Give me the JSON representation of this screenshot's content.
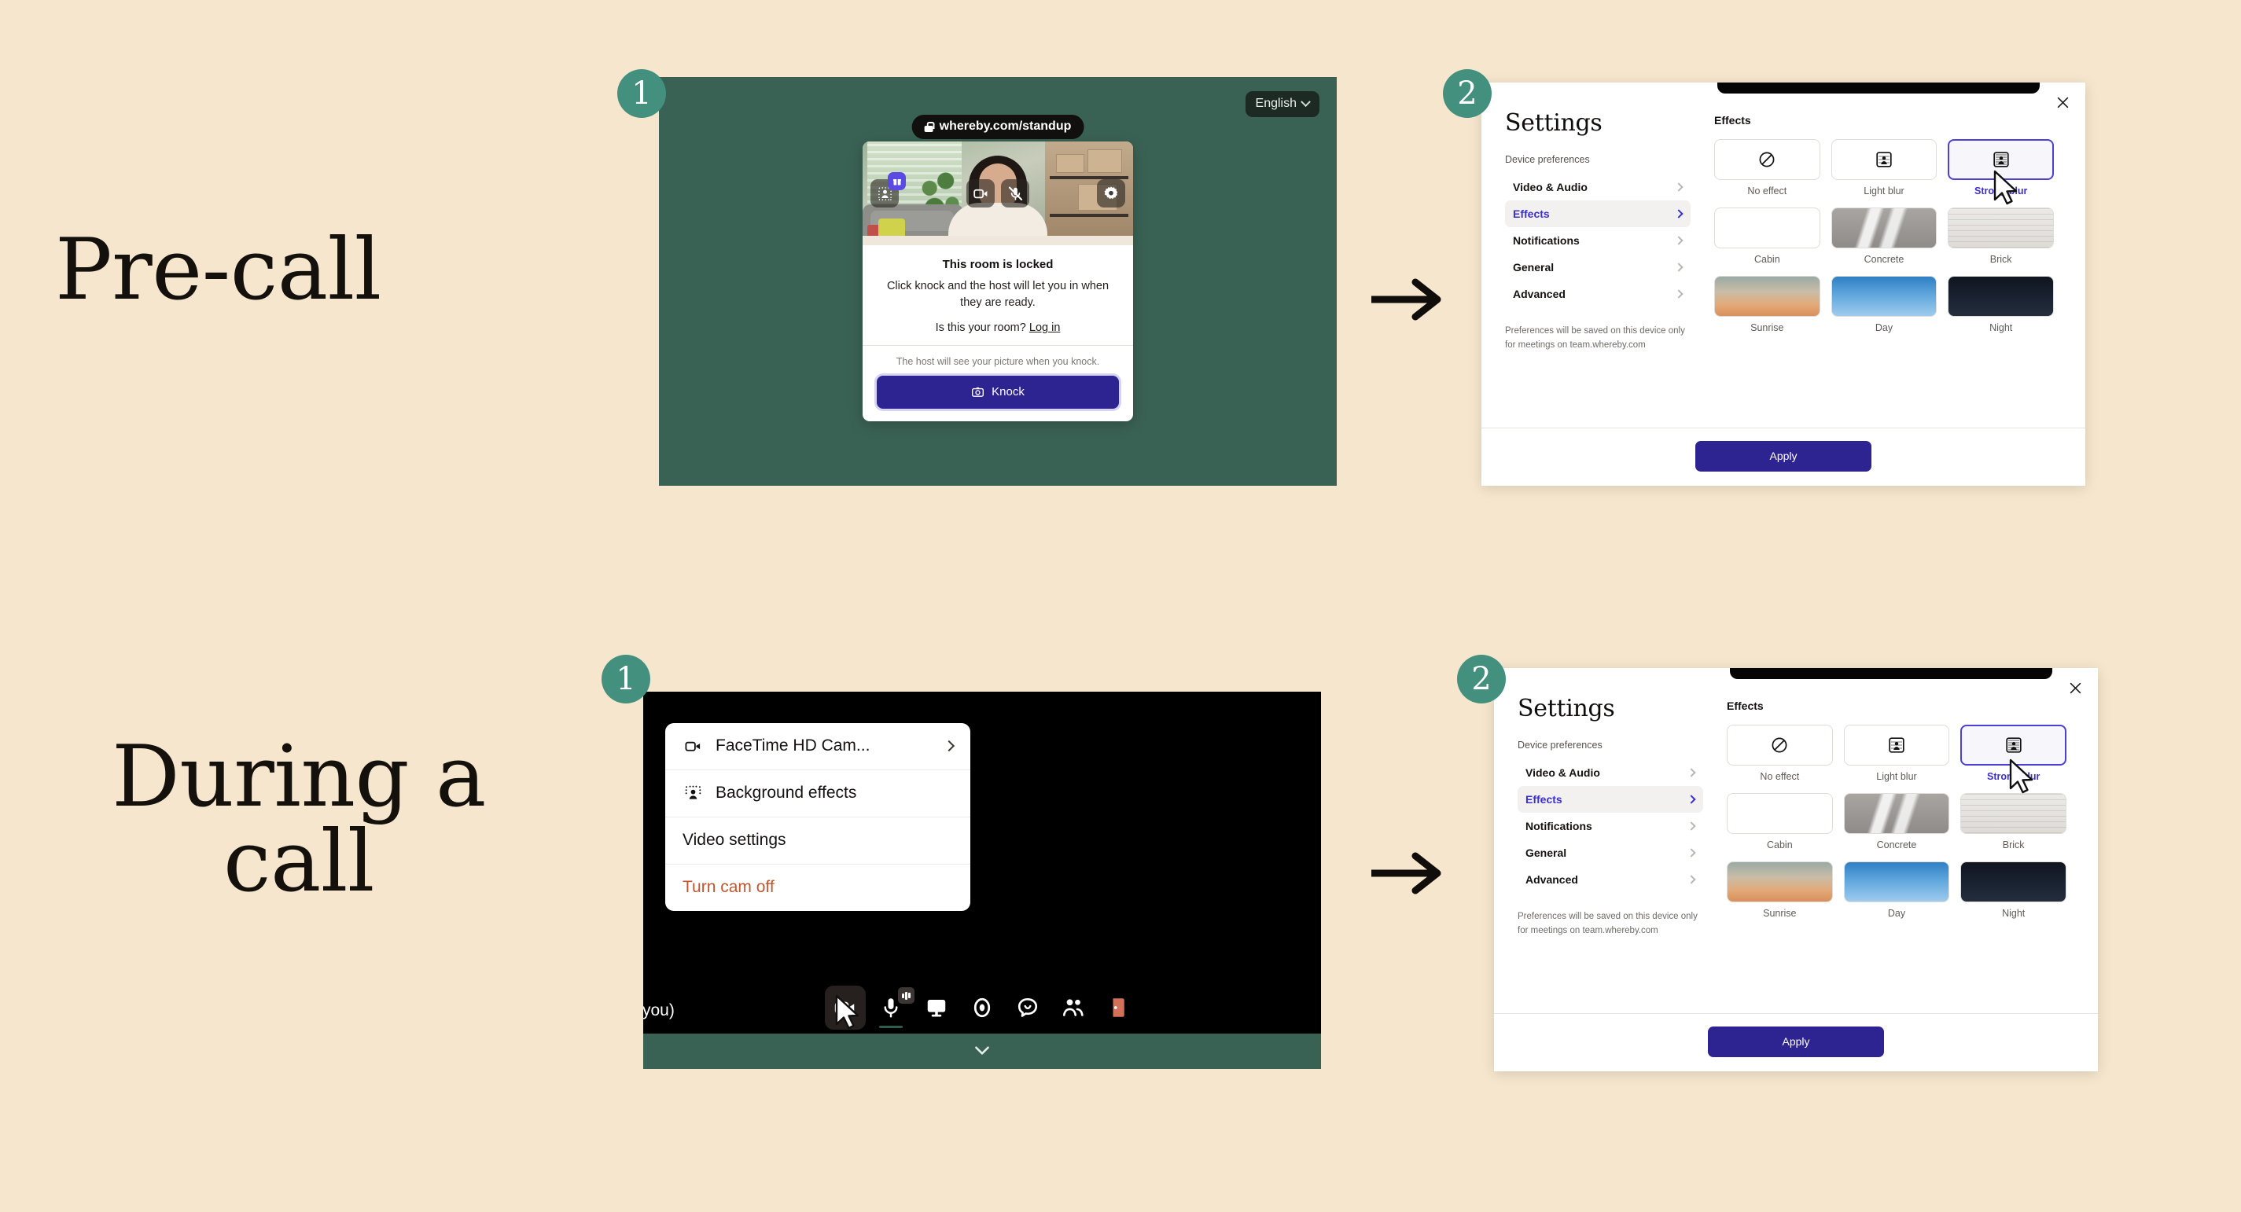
{
  "page": {
    "background_color": "#f5e6cd",
    "accent_teal": "#43907f",
    "accent_indigo": "#2d2391",
    "brand_green": "#3a6254"
  },
  "sections": [
    {
      "id": "precall",
      "heading": "Pre-call"
    },
    {
      "id": "during",
      "heading": "During a\ncall"
    }
  ],
  "badges": {
    "precall_step1": "1",
    "precall_step2": "2",
    "during_step1": "1",
    "during_step2": "2"
  },
  "precall": {
    "language_selector": {
      "label": "English",
      "icon": "chevron-down-icon"
    },
    "url_pill": {
      "text": "whereby.com/standup",
      "icon": "lock-icon"
    },
    "preview_controls": [
      {
        "name": "effects-button",
        "icon": "background-effects-icon",
        "badge": "gift-icon"
      },
      {
        "name": "camera-button",
        "icon": "camera-icon"
      },
      {
        "name": "mic-button",
        "icon": "mic-muted-icon"
      },
      {
        "name": "settings-button",
        "icon": "gear-icon"
      }
    ],
    "card": {
      "title": "This room is locked",
      "body": "Click knock and the host will let you in when they are ready.",
      "login_prompt": "Is this your room?",
      "login_link": "Log in",
      "footer_note": "The host will see your picture when you knock.",
      "knock_button": "Knock",
      "knock_icon": "camera-photo-icon"
    }
  },
  "settings": {
    "title": "Settings",
    "close_icon": "close-icon",
    "subhead": "Device preferences",
    "nav": [
      {
        "label": "Video & Audio",
        "active": false
      },
      {
        "label": "Effects",
        "active": true
      },
      {
        "label": "Notifications",
        "active": false
      },
      {
        "label": "General",
        "active": false
      },
      {
        "label": "Advanced",
        "active": false
      }
    ],
    "note": "Preferences will be saved on this device only for meetings on team.whereby.com",
    "content_title": "Effects",
    "effects": [
      {
        "label": "No effect",
        "kind": "icon",
        "icon": "no-effect-icon",
        "selected": false
      },
      {
        "label": "Light blur",
        "kind": "icon",
        "icon": "light-blur-icon",
        "selected": false
      },
      {
        "label": "Strong blur",
        "kind": "icon",
        "icon": "strong-blur-icon",
        "selected": true
      },
      {
        "label": "Cabin",
        "kind": "image",
        "texture": "tex-cabin",
        "selected": false
      },
      {
        "label": "Concrete",
        "kind": "image",
        "texture": "tex-concrete",
        "selected": false
      },
      {
        "label": "Brick",
        "kind": "image",
        "texture": "tex-brick",
        "selected": false
      },
      {
        "label": "Sunrise",
        "kind": "image",
        "texture": "tex-sunrise",
        "selected": false
      },
      {
        "label": "Day",
        "kind": "image",
        "texture": "tex-day",
        "selected": false
      },
      {
        "label": "Night",
        "kind": "image",
        "texture": "tex-night",
        "selected": false
      }
    ],
    "apply_button": "Apply"
  },
  "during_call": {
    "participant_label": "(you)",
    "camera_menu": [
      {
        "label": "FaceTime HD Cam...",
        "icon": "camera-icon",
        "has_submenu": true,
        "danger": false
      },
      {
        "label": "Background effects",
        "icon": "background-effects-icon",
        "has_submenu": false,
        "danger": false
      },
      {
        "label": "Video settings",
        "icon": null,
        "has_submenu": false,
        "danger": false
      },
      {
        "label": "Turn cam off",
        "icon": null,
        "has_submenu": false,
        "danger": true
      }
    ],
    "toolbar": [
      {
        "name": "camera-button",
        "icon": "camera-icon",
        "active": true
      },
      {
        "name": "mic-button",
        "icon": "mic-icon",
        "active": false
      },
      {
        "name": "screenshare-button",
        "icon": "screen-icon",
        "active": false
      },
      {
        "name": "record-button",
        "icon": "record-icon",
        "active": false
      },
      {
        "name": "chat-button",
        "icon": "chat-icon",
        "active": false
      },
      {
        "name": "people-button",
        "icon": "people-icon",
        "active": false
      },
      {
        "name": "leave-button",
        "icon": "leave-door-icon",
        "active": false
      }
    ],
    "collapse_icon": "chevron-down-icon"
  },
  "flow": {
    "arrow_icon": "arrow-right-icon"
  }
}
